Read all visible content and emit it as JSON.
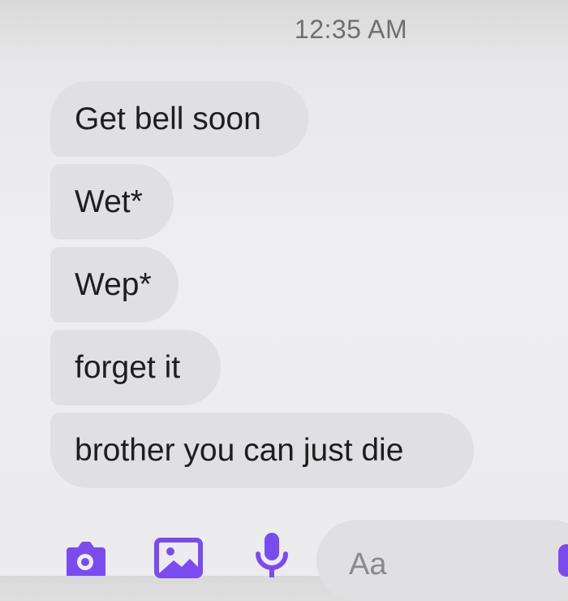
{
  "header": {
    "timestamp": "12:35 AM"
  },
  "messages": [
    {
      "text": "Get bell soon"
    },
    {
      "text": "Wet*"
    },
    {
      "text": "Wep*"
    },
    {
      "text": "forget it"
    },
    {
      "text": "brother you can just die"
    }
  ],
  "composer": {
    "placeholder": "Aa",
    "icons": [
      "camera-icon",
      "image-icon",
      "mic-icon"
    ],
    "accent_color": "#7a4cf0"
  }
}
